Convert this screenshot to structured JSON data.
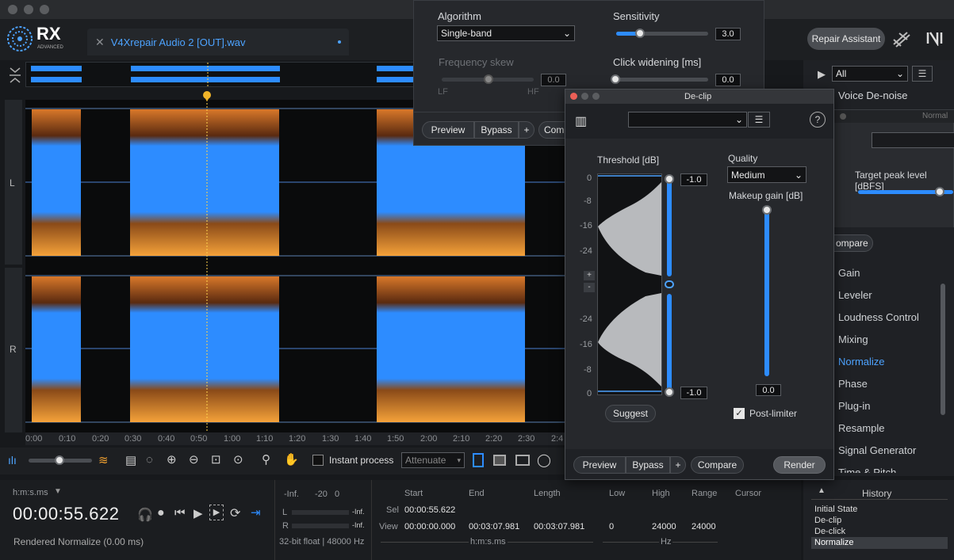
{
  "window": {
    "file_tab": "V4Xrepair Audio 2 [OUT].wav",
    "repair_assistant": "Repair Assistant",
    "logo_text": "RX",
    "logo_sub": "ADVANCED"
  },
  "channels": {
    "left": "L",
    "right": "R"
  },
  "ruler": [
    "0:00",
    "0:10",
    "0:20",
    "0:30",
    "0:40",
    "0:50",
    "1:00",
    "1:10",
    "1:20",
    "1:30",
    "1:40",
    "1:50",
    "2:00",
    "2:10",
    "2:20",
    "2:30",
    "2:4"
  ],
  "toolbar": {
    "instant_process": "Instant process",
    "mode": "Attenuate"
  },
  "declick": {
    "algorithm_label": "Algorithm",
    "algorithm_value": "Single-band",
    "sensitivity_label": "Sensitivity",
    "sensitivity_value": "3.0",
    "sensitivity_level": 0.3,
    "freq_skew_label": "Frequency skew",
    "freq_skew_value": "0.0",
    "lf": "LF",
    "hf": "HF",
    "click_widening_label": "Click widening [ms]",
    "click_widening_value": "0.0",
    "preview": "Preview",
    "bypass": "Bypass",
    "plus": "+",
    "compare": "Com"
  },
  "declip": {
    "title": "De-clip",
    "threshold_label": "Threshold [dB]",
    "scale_top": [
      "0",
      "-8",
      "-16",
      "-24"
    ],
    "scale_bottom": [
      "-24",
      "-16",
      "-8",
      "0"
    ],
    "upper_value": "-1.0",
    "lower_value": "-1.0",
    "quality_label": "Quality",
    "quality_value": "Medium",
    "makeup_label": "Makeup gain [dB]",
    "makeup_value": "0.0",
    "suggest": "Suggest",
    "post_limiter": "Post-limiter",
    "preview": "Preview",
    "bypass": "Bypass",
    "plus": "+",
    "compare": "Compare",
    "render": "Render"
  },
  "right": {
    "filter": "All",
    "voice_denoise": "Voice De-noise",
    "normal_title": "Normal",
    "target_peak": "Target peak level [dBFS]",
    "compare": "ompare",
    "modules": [
      "Gain",
      "Leveler",
      "Loudness Control",
      "Mixing",
      "Normalize",
      "Phase",
      "Plug-in",
      "Resample",
      "Signal Generator",
      "Time & Pitch"
    ],
    "active_module": "Normalize"
  },
  "transport": {
    "time_format": "h:m:s.ms",
    "time": "00:00:55.622",
    "status": "Rendered Normalize (0.00 ms)"
  },
  "meters": {
    "inf": "-Inf.",
    "m20": "-20",
    "zero": "0",
    "l": "L",
    "r": "R",
    "l_val": "-Inf.",
    "r_val": "-Inf.",
    "format": "32-bit float | 48000 Hz"
  },
  "selection": {
    "start": "Start",
    "end": "End",
    "length": "Length",
    "sel": "Sel",
    "view": "View",
    "sel_start": "00:00:55.622",
    "view_start": "00:00:00.000",
    "view_end": "00:03:07.981",
    "view_length": "00:03:07.981",
    "unit": "h:m:s.ms"
  },
  "freq": {
    "low": "Low",
    "high": "High",
    "range": "Range",
    "cursor": "Cursor",
    "low_val": "0",
    "high_val": "24000",
    "range_val": "24000",
    "unit": "Hz"
  },
  "history": {
    "title": "History",
    "items": [
      "Initial State",
      "De-clip",
      "De-click",
      "Normalize"
    ]
  }
}
